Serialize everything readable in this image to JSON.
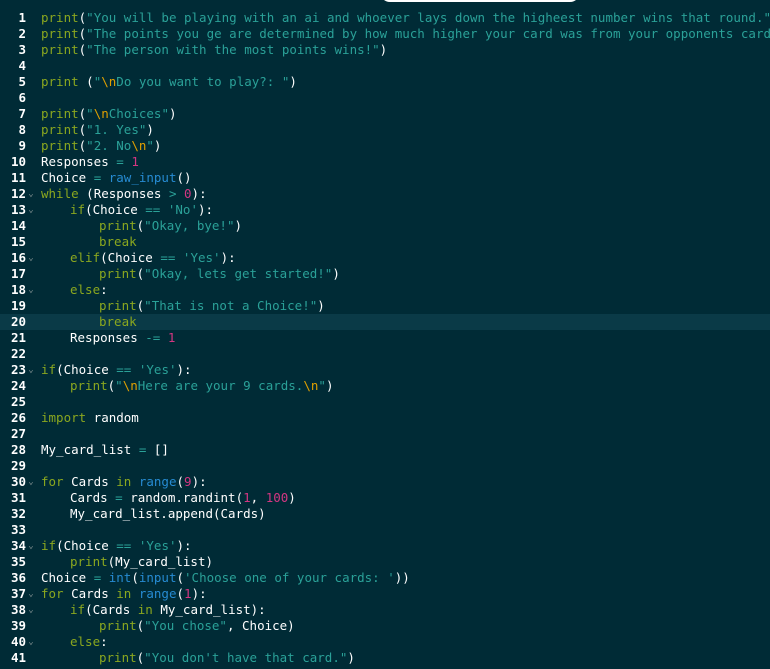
{
  "editor": {
    "active_line": 20,
    "colors": {
      "background": "#002b36",
      "keyword": "#8aa71f",
      "string": "#2aa198",
      "number": "#d33682",
      "builtin": "#268bd2",
      "escape": "#e0a000",
      "text": "#ffffff",
      "active_line": "#0a3a47"
    },
    "lines": [
      {
        "n": "1",
        "indent": 0,
        "fold": false,
        "tokens": [
          [
            "k",
            "print"
          ],
          [
            "t",
            "("
          ],
          [
            "s",
            "\"You will be playing with an ai and whoever lays down the higheest number wins that round.\""
          ],
          [
            "t",
            ")"
          ]
        ]
      },
      {
        "n": "2",
        "indent": 0,
        "fold": false,
        "tokens": [
          [
            "k",
            "print"
          ],
          [
            "t",
            "("
          ],
          [
            "s",
            "\"The points you ge are determined by how much higher your card was from your opponents card.\""
          ],
          [
            "t",
            ")"
          ]
        ]
      },
      {
        "n": "3",
        "indent": 0,
        "fold": false,
        "tokens": [
          [
            "k",
            "print"
          ],
          [
            "t",
            "("
          ],
          [
            "s",
            "\"The person with the most points wins!\""
          ],
          [
            "t",
            ")"
          ]
        ]
      },
      {
        "n": "4",
        "indent": 0,
        "fold": false,
        "tokens": []
      },
      {
        "n": "5",
        "indent": 0,
        "fold": false,
        "tokens": [
          [
            "k",
            "print"
          ],
          [
            "t",
            " ("
          ],
          [
            "s",
            "\""
          ],
          [
            "e",
            "\\n"
          ],
          [
            "s",
            "Do you want to play?: \""
          ],
          [
            "t",
            ")"
          ]
        ]
      },
      {
        "n": "6",
        "indent": 0,
        "fold": false,
        "tokens": []
      },
      {
        "n": "7",
        "indent": 0,
        "fold": false,
        "tokens": [
          [
            "k",
            "print"
          ],
          [
            "t",
            "("
          ],
          [
            "s",
            "\""
          ],
          [
            "e",
            "\\n"
          ],
          [
            "s",
            "Choices\""
          ],
          [
            "t",
            ")"
          ]
        ]
      },
      {
        "n": "8",
        "indent": 0,
        "fold": false,
        "tokens": [
          [
            "k",
            "print"
          ],
          [
            "t",
            "("
          ],
          [
            "s",
            "\"1. Yes\""
          ],
          [
            "t",
            ")"
          ]
        ]
      },
      {
        "n": "9",
        "indent": 0,
        "fold": false,
        "tokens": [
          [
            "k",
            "print"
          ],
          [
            "t",
            "("
          ],
          [
            "s",
            "\"2. No"
          ],
          [
            "e",
            "\\n"
          ],
          [
            "s",
            "\""
          ],
          [
            "t",
            ")"
          ]
        ]
      },
      {
        "n": "10",
        "indent": 0,
        "fold": false,
        "tokens": [
          [
            "t",
            "Responses "
          ],
          [
            "o",
            "="
          ],
          [
            "t",
            " "
          ],
          [
            "n",
            "1"
          ]
        ]
      },
      {
        "n": "11",
        "indent": 0,
        "fold": false,
        "tokens": [
          [
            "t",
            "Choice "
          ],
          [
            "o",
            "="
          ],
          [
            "t",
            " "
          ],
          [
            "b",
            "raw_input"
          ],
          [
            "t",
            "()"
          ]
        ]
      },
      {
        "n": "12",
        "indent": 0,
        "fold": true,
        "tokens": [
          [
            "k",
            "while"
          ],
          [
            "t",
            " (Responses "
          ],
          [
            "o",
            ">"
          ],
          [
            "t",
            " "
          ],
          [
            "n",
            "0"
          ],
          [
            "t",
            "):"
          ]
        ]
      },
      {
        "n": "13",
        "indent": 1,
        "fold": true,
        "tokens": [
          [
            "k",
            "if"
          ],
          [
            "t",
            "(Choice "
          ],
          [
            "o",
            "=="
          ],
          [
            "t",
            " "
          ],
          [
            "s",
            "'No'"
          ],
          [
            "t",
            "):"
          ]
        ]
      },
      {
        "n": "14",
        "indent": 2,
        "fold": false,
        "tokens": [
          [
            "k",
            "print"
          ],
          [
            "t",
            "("
          ],
          [
            "s",
            "\"Okay, bye!\""
          ],
          [
            "t",
            ")"
          ]
        ]
      },
      {
        "n": "15",
        "indent": 2,
        "fold": false,
        "tokens": [
          [
            "k",
            "break"
          ]
        ]
      },
      {
        "n": "16",
        "indent": 1,
        "fold": true,
        "tokens": [
          [
            "k",
            "elif"
          ],
          [
            "t",
            "(Choice "
          ],
          [
            "o",
            "=="
          ],
          [
            "t",
            " "
          ],
          [
            "s",
            "'Yes'"
          ],
          [
            "t",
            "):"
          ]
        ]
      },
      {
        "n": "17",
        "indent": 2,
        "fold": false,
        "tokens": [
          [
            "k",
            "print"
          ],
          [
            "t",
            "("
          ],
          [
            "s",
            "\"Okay, lets get started!\""
          ],
          [
            "t",
            ")"
          ]
        ]
      },
      {
        "n": "18",
        "indent": 1,
        "fold": true,
        "tokens": [
          [
            "k",
            "else"
          ],
          [
            "t",
            ":"
          ]
        ]
      },
      {
        "n": "19",
        "indent": 2,
        "fold": false,
        "tokens": [
          [
            "k",
            "print"
          ],
          [
            "t",
            "("
          ],
          [
            "s",
            "\"That is not a Choice!\""
          ],
          [
            "t",
            ")"
          ]
        ]
      },
      {
        "n": "20",
        "indent": 2,
        "fold": false,
        "tokens": [
          [
            "k",
            "break"
          ]
        ]
      },
      {
        "n": "21",
        "indent": 1,
        "fold": false,
        "tokens": [
          [
            "t",
            "Responses "
          ],
          [
            "o",
            "-="
          ],
          [
            "t",
            " "
          ],
          [
            "n",
            "1"
          ]
        ]
      },
      {
        "n": "22",
        "indent": 0,
        "fold": false,
        "tokens": []
      },
      {
        "n": "23",
        "indent": 0,
        "fold": true,
        "tokens": [
          [
            "k",
            "if"
          ],
          [
            "t",
            "(Choice "
          ],
          [
            "o",
            "=="
          ],
          [
            "t",
            " "
          ],
          [
            "s",
            "'Yes'"
          ],
          [
            "t",
            "):"
          ]
        ]
      },
      {
        "n": "24",
        "indent": 1,
        "fold": false,
        "tokens": [
          [
            "k",
            "print"
          ],
          [
            "t",
            "("
          ],
          [
            "s",
            "\""
          ],
          [
            "e",
            "\\n"
          ],
          [
            "s",
            "Here are your 9 cards."
          ],
          [
            "e",
            "\\n"
          ],
          [
            "s",
            "\""
          ],
          [
            "t",
            ")"
          ]
        ]
      },
      {
        "n": "25",
        "indent": 0,
        "fold": false,
        "tokens": []
      },
      {
        "n": "26",
        "indent": 0,
        "fold": false,
        "tokens": [
          [
            "k",
            "import"
          ],
          [
            "t",
            " random"
          ]
        ]
      },
      {
        "n": "27",
        "indent": 0,
        "fold": false,
        "tokens": []
      },
      {
        "n": "28",
        "indent": 0,
        "fold": false,
        "tokens": [
          [
            "t",
            "My_card_list "
          ],
          [
            "o",
            "="
          ],
          [
            "t",
            " []"
          ]
        ]
      },
      {
        "n": "29",
        "indent": 0,
        "fold": false,
        "tokens": []
      },
      {
        "n": "30",
        "indent": 0,
        "fold": true,
        "tokens": [
          [
            "k",
            "for"
          ],
          [
            "t",
            " Cards "
          ],
          [
            "k",
            "in"
          ],
          [
            "t",
            " "
          ],
          [
            "b",
            "range"
          ],
          [
            "t",
            "("
          ],
          [
            "n",
            "9"
          ],
          [
            "t",
            "):"
          ]
        ]
      },
      {
        "n": "31",
        "indent": 1,
        "fold": false,
        "tokens": [
          [
            "t",
            "Cards "
          ],
          [
            "o",
            "="
          ],
          [
            "t",
            " random.randint("
          ],
          [
            "n",
            "1"
          ],
          [
            "t",
            ", "
          ],
          [
            "n",
            "100"
          ],
          [
            "t",
            ")"
          ]
        ]
      },
      {
        "n": "32",
        "indent": 1,
        "fold": false,
        "tokens": [
          [
            "t",
            "My_card_list.append(Cards)"
          ]
        ]
      },
      {
        "n": "33",
        "indent": 0,
        "fold": false,
        "tokens": []
      },
      {
        "n": "34",
        "indent": 0,
        "fold": true,
        "tokens": [
          [
            "k",
            "if"
          ],
          [
            "t",
            "(Choice "
          ],
          [
            "o",
            "=="
          ],
          [
            "t",
            " "
          ],
          [
            "s",
            "'Yes'"
          ],
          [
            "t",
            "):"
          ]
        ]
      },
      {
        "n": "35",
        "indent": 1,
        "fold": false,
        "tokens": [
          [
            "k",
            "print"
          ],
          [
            "t",
            "(My_card_list)"
          ]
        ]
      },
      {
        "n": "36",
        "indent": 0,
        "fold": false,
        "tokens": [
          [
            "t",
            "Choice "
          ],
          [
            "o",
            "="
          ],
          [
            "t",
            " "
          ],
          [
            "b",
            "int"
          ],
          [
            "t",
            "("
          ],
          [
            "b",
            "input"
          ],
          [
            "t",
            "("
          ],
          [
            "s",
            "'Choose one of your cards: '"
          ],
          [
            "t",
            "))"
          ]
        ]
      },
      {
        "n": "37",
        "indent": 0,
        "fold": true,
        "tokens": [
          [
            "k",
            "for"
          ],
          [
            "t",
            " Cards "
          ],
          [
            "k",
            "in"
          ],
          [
            "t",
            " "
          ],
          [
            "b",
            "range"
          ],
          [
            "t",
            "("
          ],
          [
            "n",
            "1"
          ],
          [
            "t",
            "):"
          ]
        ]
      },
      {
        "n": "38",
        "indent": 1,
        "fold": true,
        "tokens": [
          [
            "k",
            "if"
          ],
          [
            "t",
            "(Cards "
          ],
          [
            "k",
            "in"
          ],
          [
            "t",
            " My_card_list):"
          ]
        ]
      },
      {
        "n": "39",
        "indent": 2,
        "fold": false,
        "tokens": [
          [
            "k",
            "print"
          ],
          [
            "t",
            "("
          ],
          [
            "s",
            "\"You chose\""
          ],
          [
            "t",
            ", Choice)"
          ]
        ]
      },
      {
        "n": "40",
        "indent": 1,
        "fold": true,
        "tokens": [
          [
            "k",
            "else"
          ],
          [
            "t",
            ":"
          ]
        ]
      },
      {
        "n": "41",
        "indent": 2,
        "fold": false,
        "tokens": [
          [
            "k",
            "print"
          ],
          [
            "t",
            "("
          ],
          [
            "s",
            "\"You don't have that card.\""
          ],
          [
            "t",
            ")"
          ]
        ]
      }
    ]
  }
}
